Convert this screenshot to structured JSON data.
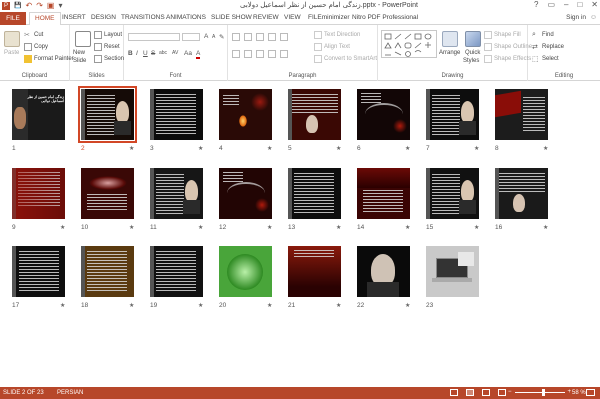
{
  "window": {
    "title": "زندگی امام حسین از نظر اسماعیل دولابی.pptx - PowerPoint",
    "controls": {
      "help": "?",
      "ribbon_options": "▭",
      "minimize": "–",
      "maximize": "□",
      "close": "✕"
    }
  },
  "quick_access": {
    "save": "💾",
    "undo": "↶",
    "redo": "↷",
    "present": "▣",
    "customize": "▾"
  },
  "tabs": {
    "file": "FILE",
    "items": [
      "HOME",
      "INSERT",
      "DESIGN",
      "TRANSITIONS",
      "ANIMATIONS",
      "SLIDE SHOW",
      "REVIEW",
      "VIEW",
      "FILEminimizer",
      "Nitro PDF Professional"
    ],
    "active": "HOME",
    "sign_in": "Sign in"
  },
  "ribbon": {
    "clipboard": {
      "paste": "Paste",
      "cut": "Cut",
      "copy": "Copy",
      "format_painter": "Format Painter",
      "label": "Clipboard"
    },
    "slides": {
      "new_slide": "New",
      "new_slide_2": "Slide",
      "layout": "Layout",
      "reset": "Reset",
      "section": "Section",
      "label": "Slides"
    },
    "font": {
      "label": "Font",
      "bold": "B",
      "italic": "I",
      "underline": "U",
      "strike": "S",
      "shadow": "abc",
      "spacing": "AV",
      "case": "Aa",
      "color": "A",
      "grow": "A",
      "shrink": "A",
      "clear": "✎"
    },
    "paragraph": {
      "text_direction": "Text Direction",
      "align_text": "Align Text",
      "convert_smartart": "Convert to SmartArt",
      "label": "Paragraph"
    },
    "drawing": {
      "arrange": "Arrange",
      "quick_styles": "Quick",
      "quick_styles_2": "Styles",
      "shape_fill": "Shape Fill",
      "shape_outline": "Shape Outline",
      "shape_effects": "Shape Effects",
      "label": "Drawing"
    },
    "editing": {
      "find": "Find",
      "replace": "Replace",
      "select": "Select",
      "label": "Editing"
    }
  },
  "slides": [
    {
      "num": "1",
      "star": ""
    },
    {
      "num": "2",
      "star": "★"
    },
    {
      "num": "3",
      "star": "★"
    },
    {
      "num": "4",
      "star": "★"
    },
    {
      "num": "5",
      "star": "★"
    },
    {
      "num": "6",
      "star": "★"
    },
    {
      "num": "7",
      "star": "★"
    },
    {
      "num": "8",
      "star": "★"
    },
    {
      "num": "9",
      "star": "★"
    },
    {
      "num": "10",
      "star": "★"
    },
    {
      "num": "11",
      "star": "★"
    },
    {
      "num": "12",
      "star": "★"
    },
    {
      "num": "13",
      "star": "★"
    },
    {
      "num": "14",
      "star": "★"
    },
    {
      "num": "15",
      "star": "★"
    },
    {
      "num": "16",
      "star": "★"
    },
    {
      "num": "17",
      "star": "★"
    },
    {
      "num": "18",
      "star": "★"
    },
    {
      "num": "19",
      "star": "★"
    },
    {
      "num": "20",
      "star": "★"
    },
    {
      "num": "21",
      "star": "★"
    },
    {
      "num": "22",
      "star": "★"
    },
    {
      "num": "23",
      "star": ""
    }
  ],
  "slide1_title": "زندگی امام حسین از نظر اسماعیل دولابی",
  "status": {
    "slide_count": "SLIDE 2 OF 23",
    "language": "PERSIAN",
    "zoom_minus": "−",
    "zoom_plus": "+",
    "zoom_level": "58 %",
    "zoom_fraction": 0.58
  },
  "colors": {
    "accent": "#b7472a",
    "selection": "#d24726",
    "status_bar": "#b7472a"
  }
}
